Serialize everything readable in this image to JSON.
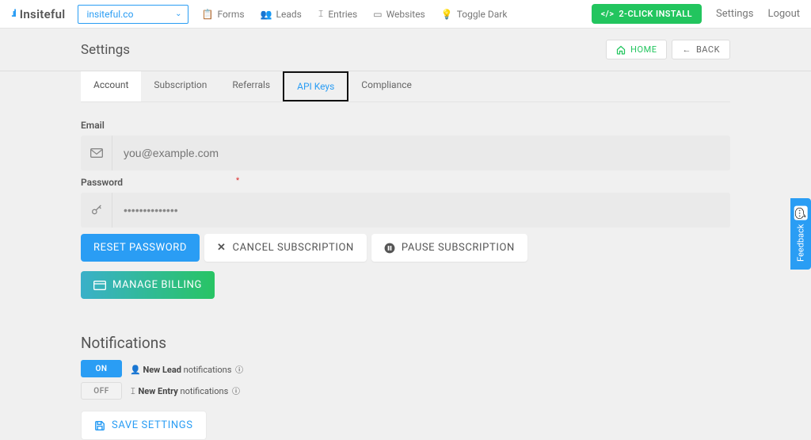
{
  "brand": {
    "name": "Insiteful"
  },
  "site_selector": {
    "value": "insiteful.co"
  },
  "nav": {
    "forms": "Forms",
    "leads": "Leads",
    "entries": "Entries",
    "websites": "Websites",
    "toggle_dark": "Toggle Dark"
  },
  "topright": {
    "install": "2-CLICK INSTALL",
    "settings": "Settings",
    "logout": "Logout"
  },
  "page": {
    "title": "Settings",
    "home": "HOME",
    "back": "BACK"
  },
  "tabs": {
    "account": "Account",
    "subscription": "Subscription",
    "referrals": "Referrals",
    "api_keys": "API Keys",
    "compliance": "Compliance"
  },
  "form": {
    "email_label": "Email",
    "email_placeholder": "you@example.com",
    "password_label": "Password",
    "password_value": "••••••••••••••"
  },
  "buttons": {
    "reset_password": "RESET PASSWORD",
    "cancel_subscription": "CANCEL SUBSCRIPTION",
    "pause_subscription": "PAUSE SUBSCRIPTION",
    "manage_billing": "MANAGE BILLING",
    "save_settings": "SAVE SETTINGS"
  },
  "notifications": {
    "heading": "Notifications",
    "on": "ON",
    "off": "OFF",
    "lead_strong": "New Lead",
    "lead_rest": " notifications",
    "entry_strong": "New Entry",
    "entry_rest": " notifications"
  },
  "feedback": {
    "label": "Feedback"
  }
}
